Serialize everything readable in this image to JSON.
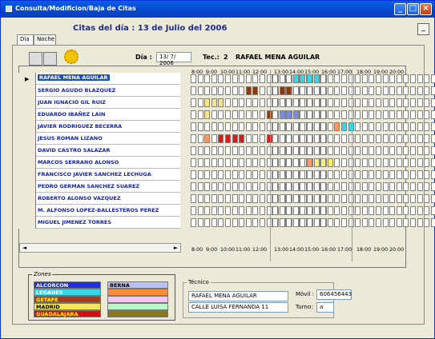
{
  "window": {
    "title": "Consulta/Modificion/Baja  de Citas"
  },
  "page": {
    "title": "Citas del día :  13 de Julio del  2006"
  },
  "tabs": [
    {
      "label": "Día"
    },
    {
      "label": "Noche"
    }
  ],
  "toolbar": {
    "dia_label": "Día :",
    "dia_value": "13/ 7/ 2006",
    "tec_label": "Tec.:",
    "tec_number": "2",
    "tec_name": "RAFAEL MENA AGUILAR"
  },
  "hours": [
    "8:00",
    "9:00",
    "10:00",
    "11:00",
    "12:00",
    "13:00",
    "14:00",
    "15:00",
    "16:00",
    "17:00",
    "18:00",
    "19:00",
    "20:00"
  ],
  "rows": [
    {
      "name": "RAFAEL MENA AGUILAR",
      "slots": [
        "",
        "",
        "",
        "",
        "",
        "",
        "",
        "",
        "",
        "",
        "",
        "",
        "#ffffff",
        "#ffffff",
        "#ffffff",
        "#ffffff",
        "",
        "",
        "",
        "#ff9966",
        "",
        "",
        "",
        "#35d7e6",
        "#35d7e6",
        "#35d7e6",
        "#35d7e6",
        "",
        "",
        "",
        "",
        "",
        "",
        "",
        "",
        "",
        "",
        "",
        "",
        "",
        "",
        "",
        "",
        ""
      ]
    },
    {
      "name": "SERGIO AGUDO BLAZQUEZ",
      "slots": [
        "",
        "",
        "",
        "",
        "",
        "",
        "",
        "",
        "#8b3a12",
        "#8b3a12",
        "",
        "",
        "",
        "",
        "",
        "",
        "",
        "",
        "",
        "#ff9966",
        "",
        "#8b3a12",
        "#8b3a12",
        "",
        "",
        "",
        "",
        "",
        "",
        "",
        "",
        "",
        "",
        "",
        "",
        "",
        "",
        "",
        "",
        "",
        "",
        "",
        "",
        ""
      ]
    },
    {
      "name": "JUAN IGNACIO GIL RUIZ",
      "slots": [
        "",
        "",
        "#f8e58c",
        "#f8e58c",
        "#f8e58c",
        "",
        "",
        "",
        "",
        "",
        "",
        "",
        "",
        "",
        "",
        "",
        "",
        "",
        "",
        "",
        "",
        "",
        "",
        "",
        "",
        "",
        "",
        "",
        "",
        "",
        "",
        "",
        "",
        "",
        "",
        "",
        "",
        "",
        "",
        "",
        "",
        "",
        "",
        ""
      ]
    },
    {
      "name": "EDUARDO IBAÑEZ LAIN",
      "slots": [
        "",
        "",
        "#f8e58c",
        "",
        "",
        "",
        "",
        "",
        "",
        "",
        "",
        "#8b3a12",
        "#8b3a12",
        "",
        "",
        "",
        "",
        "",
        "",
        "",
        "",
        "#7b8be0",
        "#7b8be0",
        "#7b8be0",
        "",
        "",
        "",
        "",
        "",
        "",
        "",
        "",
        "",
        "",
        "",
        "",
        "",
        "",
        "",
        "",
        "",
        "",
        "",
        ""
      ]
    },
    {
      "name": "JAVIER RODRIGUEZ BECERRA",
      "slots": [
        "",
        "",
        "",
        "",
        "",
        "",
        "",
        "",
        "",
        "",
        "",
        "",
        "",
        "",
        "",
        "",
        "",
        "",
        "",
        "",
        "",
        "",
        "",
        "",
        "",
        "",
        "",
        "",
        "",
        "#ff9966",
        "#35d7e6",
        "#35d7e6",
        "",
        "",
        "",
        "",
        "",
        "",
        "",
        "",
        "",
        "",
        "",
        ""
      ]
    },
    {
      "name": "JESUS ROMAN LIZANO",
      "slots": [
        "",
        "",
        "#ff9966",
        "",
        "#e01818",
        "#e01818",
        "#e01818",
        "#e01818",
        "",
        "",
        "",
        "#e01818",
        "#e01818",
        "",
        "",
        "",
        "",
        "",
        "",
        "#e01818",
        "",
        "",
        "",
        "",
        "",
        "",
        "",
        "",
        "",
        "",
        "",
        "",
        "",
        "",
        "",
        "",
        "",
        "",
        "",
        "",
        "",
        "",
        "",
        ""
      ]
    },
    {
      "name": "DAVID CASTRO SALAZAR",
      "slots": []
    },
    {
      "name": "MARCOS SERRANO ALONSO",
      "slots": [
        "",
        "",
        "",
        "",
        "",
        "",
        "",
        "",
        "",
        "",
        "",
        "",
        "",
        "",
        "",
        "",
        "",
        "",
        "",
        "",
        "",
        "",
        "",
        "",
        "",
        "#ff9966",
        "#f8f06a",
        "#f8f06a",
        "#f8f06a",
        "",
        "",
        "",
        "",
        "",
        "",
        "",
        "",
        "",
        "",
        "",
        "",
        "",
        "",
        ""
      ]
    },
    {
      "name": "FRANCISCO JAVIER  SANCHEZ LECHUGA",
      "slots": []
    },
    {
      "name": "PEDRO GERMAN SANCHEZ SUAREZ",
      "slots": []
    },
    {
      "name": "ROBERTO ALONSO VAZQUEZ",
      "slots": []
    },
    {
      "name": "M. ALFONSO LOPEZ-BALLESTEROS PEREZ",
      "slots": []
    },
    {
      "name": "MIGUEL JIMENEZ TORRES",
      "slots": []
    }
  ],
  "zones": {
    "title": "Zones",
    "left": [
      {
        "name": "ALCORCON",
        "bg": "#1d2fe0",
        "fg": "#ffffff"
      },
      {
        "name": "LEGANES",
        "bg": "#35d7e6",
        "fg": "#ffffff"
      },
      {
        "name": "GETAFE",
        "bg": "#a43d1c",
        "fg": "#ffff00"
      },
      {
        "name": "MADRID",
        "bg": "#f5e55c",
        "fg": "#000000"
      },
      {
        "name": "GUADALAJARA",
        "bg": "#d40f0f",
        "fg": "#ffff00"
      }
    ],
    "right": [
      {
        "name": "BERNA",
        "bg": "#b7c1f4",
        "fg": "#000000"
      },
      {
        "name": "",
        "bg": "#ff8c3a",
        "fg": "#000000"
      },
      {
        "name": "",
        "bg": "#f6c4f4",
        "fg": "#000000"
      },
      {
        "name": "",
        "bg": "#b9f8c6",
        "fg": "#000000"
      },
      {
        "name": "",
        "bg": "#8f761c",
        "fg": "#000000"
      }
    ]
  },
  "tecnico": {
    "title": "Técnico",
    "name": "RAFAEL MENA AGUILAR",
    "address": "CALLE LUISA FERNANDA 11",
    "movil_label": "Móvil :",
    "movil_value": "606456443",
    "turno_label": "Turno:",
    "turno_value": "a"
  }
}
